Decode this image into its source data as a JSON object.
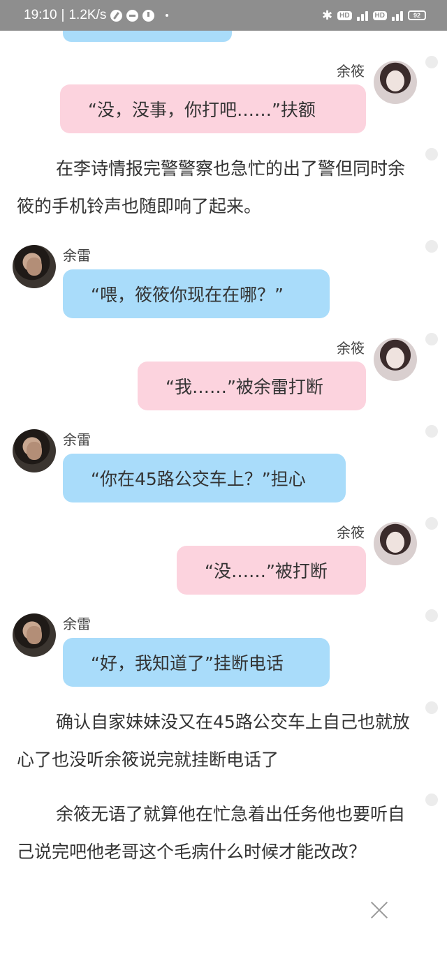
{
  "status_bar": {
    "time": "19:10",
    "separator": "|",
    "network_speed": "1.2K/s",
    "bluetooth_icon": "bluetooth-icon",
    "hd1": "HD",
    "hd2": "HD",
    "battery": "92"
  },
  "messages": [
    {
      "speaker": "余筱",
      "text": "“没，没事，你打吧……”扶额"
    },
    {
      "speaker": "余雷",
      "text": "“喂，筱筱你现在在哪？”"
    },
    {
      "speaker": "余筱",
      "text": "“我……”被余雷打断"
    },
    {
      "speaker": "余雷",
      "text": "“你在45路公交车上？”担心"
    },
    {
      "speaker": "余筱",
      "text": "“没……”被打断"
    },
    {
      "speaker": "余雷",
      "text": "“好，我知道了”挂断电话"
    }
  ],
  "paragraphs": [
    "在李诗情报完警警察也急忙的出了警但同时余筱的手机铃声也随即响了起来。",
    "确认自家妹妹没又在45路公交车上自己也就放心了也没听余筱说完就挂断电话了",
    "余筱无语了就算他在忙急着出任务他也要听自己说完吧他老哥这个毛病什么时候才能改改？"
  ],
  "colors": {
    "pink_bubble": "#fcd3de",
    "blue_bubble": "#a9dcfa",
    "status_bar": "#8e8e8e"
  }
}
